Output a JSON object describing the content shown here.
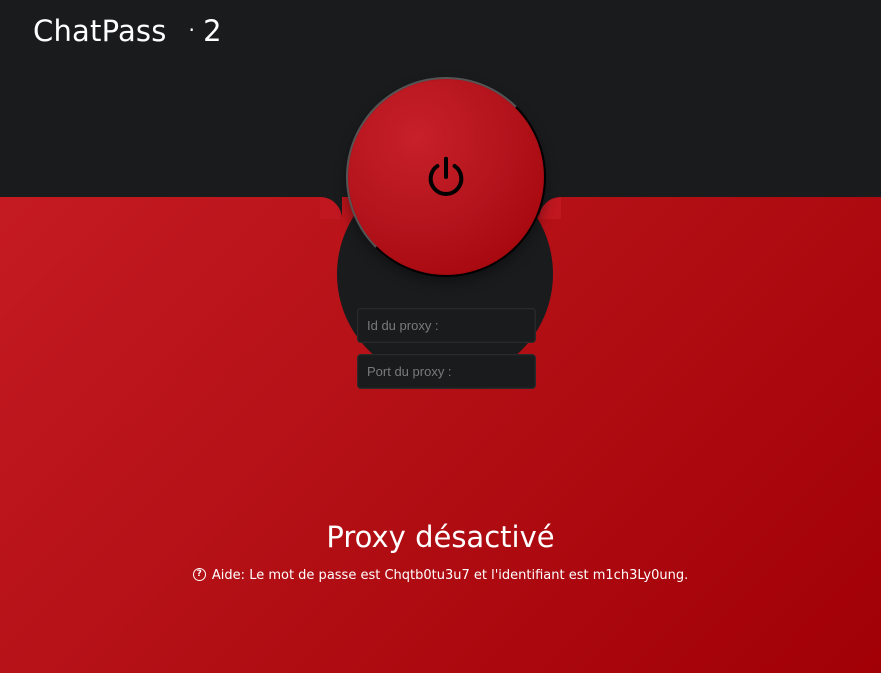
{
  "app": {
    "title": "ChatPass",
    "bullet": "·",
    "level": "2"
  },
  "power": {
    "icon": "power-icon"
  },
  "proxy": {
    "id_placeholder": "Id du proxy :",
    "port_placeholder": "Port du proxy :"
  },
  "status": {
    "title": "Proxy désactivé",
    "help_prefix": "Aide: ",
    "help_text": "Le mot de passe est Chqtb0tu3u7 et l'identifiant est m1ch3Ly0ung."
  },
  "colors": {
    "top_background": "#1a1b1d",
    "accent_red": "#b31016",
    "text_white": "#ffffff"
  }
}
